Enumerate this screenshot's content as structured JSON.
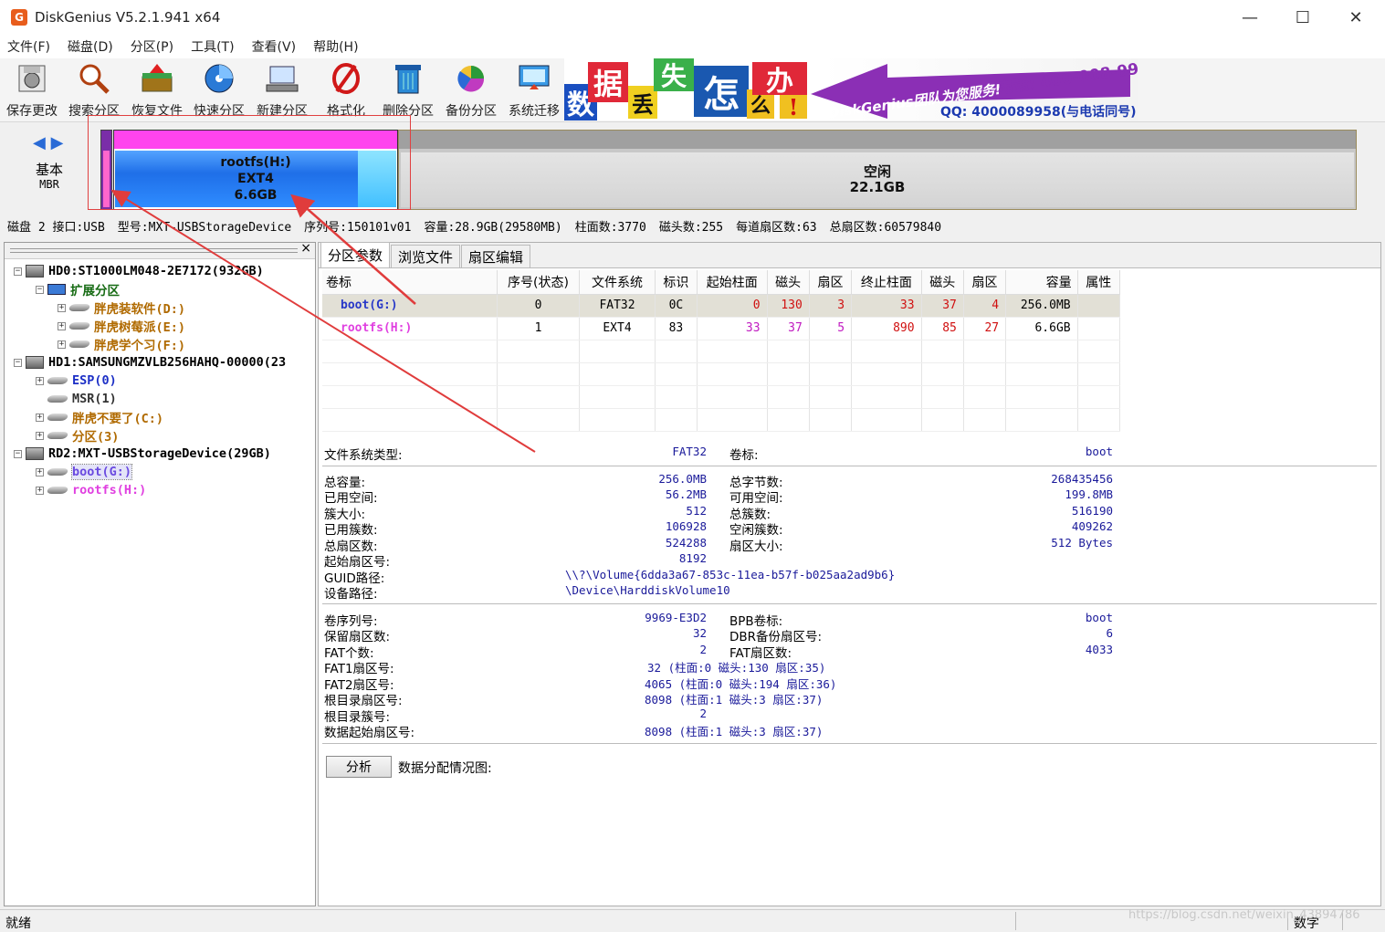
{
  "window": {
    "title": "DiskGenius V5.2.1.941 x64",
    "app_icon": "G",
    "minimize": "—",
    "maximize": "☐",
    "close": "✕"
  },
  "menu": [
    "文件(F)",
    "磁盘(D)",
    "分区(P)",
    "工具(T)",
    "查看(V)",
    "帮助(H)"
  ],
  "toolbar": [
    {
      "label": "保存更改",
      "icon": "save-disk-icon"
    },
    {
      "label": "搜索分区",
      "icon": "magnifier-icon"
    },
    {
      "label": "恢复文件",
      "icon": "recover-box-icon"
    },
    {
      "label": "快速分区",
      "icon": "quick-partition-disc-icon"
    },
    {
      "label": "新建分区",
      "icon": "new-partition-icon"
    },
    {
      "label": "格式化",
      "icon": "format-icon"
    },
    {
      "label": "删除分区",
      "icon": "trash-icon"
    },
    {
      "label": "备份分区",
      "icon": "backup-pie-icon"
    },
    {
      "label": "系统迁移",
      "icon": "system-migrate-icon"
    }
  ],
  "banner": {
    "chars": [
      "数",
      "据",
      "丢",
      "失",
      "怎",
      "么",
      "办",
      "!"
    ],
    "team_text": "DiskGenius团队为您服务!",
    "phone": "电话: 400-008-9958",
    "qq": "QQ: 4000089958(与电话同号)"
  },
  "disk_map": {
    "nav": "◀ ▶",
    "type": "基本",
    "scheme": "MBR",
    "rootfs": {
      "name": "rootfs(H:)",
      "fs": "EXT4",
      "size": "6.6GB"
    },
    "free": {
      "name": "空闲",
      "size": "22.1GB"
    }
  },
  "disk_info": [
    "磁盘 2 接口:USB",
    "型号:MXT-USBStorageDevice",
    "序列号:150101v01",
    "容量:28.9GB(29580MB)",
    "柱面数:3770",
    "磁头数:255",
    "每道扇区数:63",
    "总扇区数:60579840"
  ],
  "tree": {
    "close": "×",
    "nodes": [
      {
        "label": "HD0:ST1000LM048-2E7172(932GB)"
      },
      {
        "label": "扩展分区"
      },
      {
        "label": "胖虎装软件(D:)"
      },
      {
        "label": "胖虎树莓派(E:)"
      },
      {
        "label": "胖虎学个习(F:)"
      },
      {
        "label": "HD1:SAMSUNGMZVLB256HAHQ-00000(23"
      },
      {
        "label": "ESP(0)"
      },
      {
        "label": "MSR(1)"
      },
      {
        "label": "胖虎不要了(C:)"
      },
      {
        "label": "分区(3)"
      },
      {
        "label": "RD2:MXT-USBStorageDevice(29GB)"
      },
      {
        "label": "boot(G:)"
      },
      {
        "label": "rootfs(H:)"
      }
    ]
  },
  "tabs": [
    "分区参数",
    "浏览文件",
    "扇区编辑"
  ],
  "table": {
    "headers": [
      "卷标",
      "序号(状态)",
      "文件系统",
      "标识",
      "起始柱面",
      "磁头",
      "扇区",
      "终止柱面",
      "磁头",
      "扇区",
      "容量",
      "属性"
    ],
    "rows": [
      [
        "boot(G:)",
        "0",
        "FAT32",
        "0C",
        "0",
        "130",
        "3",
        "33",
        "37",
        "4",
        "256.0MB",
        ""
      ],
      [
        "rootfs(H:)",
        "1",
        "EXT4",
        "83",
        "33",
        "37",
        "5",
        "890",
        "85",
        "27",
        "6.6GB",
        ""
      ]
    ]
  },
  "details": {
    "fs_type_label": "文件系统类型:",
    "fs_type": "FAT32",
    "vol_label_label": "卷标:",
    "vol_label": "boot",
    "total_cap_label": "总容量:",
    "total_cap": "256.0MB",
    "total_bytes_label": "总字节数:",
    "total_bytes": "268435456",
    "used_label": "已用空间:",
    "used": "56.2MB",
    "free_label": "可用空间:",
    "free": "199.8MB",
    "cluster_size_label": "簇大小:",
    "cluster_size": "512",
    "total_clusters_label": "总簇数:",
    "total_clusters": "516190",
    "used_clusters_label": "已用簇数:",
    "used_clusters": "106928",
    "free_clusters_label": "空闲簇数:",
    "free_clusters": "409262",
    "total_sectors_label": "总扇区数:",
    "total_sectors": "524288",
    "sector_size_label": "扇区大小:",
    "sector_size": "512 Bytes",
    "start_sector_label": "起始扇区号:",
    "start_sector": "8192",
    "guid_label": "GUID路径:",
    "guid": "\\\\?\\Volume{6dda3a67-853c-11ea-b57f-b025aa2ad9b6}",
    "device_label": "设备路径:",
    "device": "\\Device\\HarddiskVolume10",
    "serial_label": "卷序列号:",
    "serial": "9969-E3D2",
    "bpb_label": "BPB卷标:",
    "bpb": "boot",
    "reserved_label": "保留扇区数:",
    "reserved": "32",
    "dbr_label": "DBR备份扇区号:",
    "dbr": "6",
    "fat_count_label": "FAT个数:",
    "fat_count": "2",
    "fat_sectors_label": "FAT扇区数:",
    "fat_sectors": "4033",
    "fat1_label": "FAT1扇区号:",
    "fat1": "32 (柱面:0 磁头:130 扇区:35)",
    "fat2_label": "FAT2扇区号:",
    "fat2": "4065 (柱面:0 磁头:194 扇区:36)",
    "root_sector_label": "根目录扇区号:",
    "root_sector": "8098 (柱面:1 磁头:3 扇区:37)",
    "root_cluster_label": "根目录簇号:",
    "root_cluster": "2",
    "data_start_label": "数据起始扇区号:",
    "data_start": "8098 (柱面:1 磁头:3 扇区:37)",
    "analyze_btn": "分析",
    "alloc_label": "数据分配情况图:"
  },
  "status": {
    "left": "就绪",
    "right": "数字",
    "watermark": "https://blog.csdn.net/weixin_43894786"
  },
  "colors": {
    "annotation": "#e03c3c",
    "rootfs_top": "#ff44ee",
    "rootfs_body": "#2f7cf0",
    "free_body": "#d8d8d8",
    "selected_row": "#e2e0d6"
  }
}
